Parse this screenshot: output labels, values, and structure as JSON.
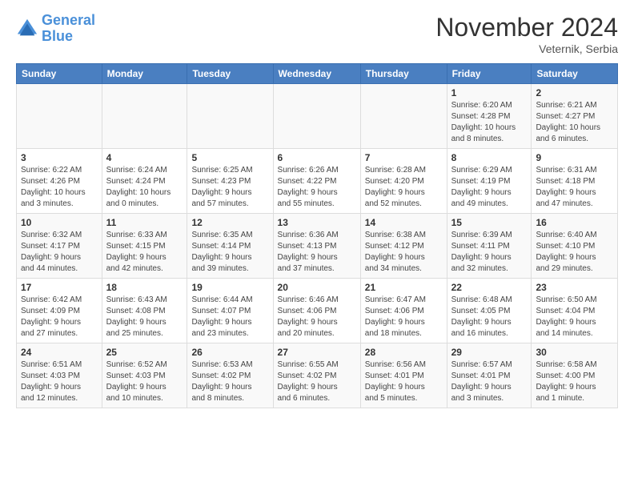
{
  "header": {
    "logo_line1": "General",
    "logo_line2": "Blue",
    "title": "November 2024",
    "location": "Veternik, Serbia"
  },
  "days_of_week": [
    "Sunday",
    "Monday",
    "Tuesday",
    "Wednesday",
    "Thursday",
    "Friday",
    "Saturday"
  ],
  "weeks": [
    [
      {
        "day": "",
        "info": ""
      },
      {
        "day": "",
        "info": ""
      },
      {
        "day": "",
        "info": ""
      },
      {
        "day": "",
        "info": ""
      },
      {
        "day": "",
        "info": ""
      },
      {
        "day": "1",
        "info": "Sunrise: 6:20 AM\nSunset: 4:28 PM\nDaylight: 10 hours\nand 8 minutes."
      },
      {
        "day": "2",
        "info": "Sunrise: 6:21 AM\nSunset: 4:27 PM\nDaylight: 10 hours\nand 6 minutes."
      }
    ],
    [
      {
        "day": "3",
        "info": "Sunrise: 6:22 AM\nSunset: 4:26 PM\nDaylight: 10 hours\nand 3 minutes."
      },
      {
        "day": "4",
        "info": "Sunrise: 6:24 AM\nSunset: 4:24 PM\nDaylight: 10 hours\nand 0 minutes."
      },
      {
        "day": "5",
        "info": "Sunrise: 6:25 AM\nSunset: 4:23 PM\nDaylight: 9 hours\nand 57 minutes."
      },
      {
        "day": "6",
        "info": "Sunrise: 6:26 AM\nSunset: 4:22 PM\nDaylight: 9 hours\nand 55 minutes."
      },
      {
        "day": "7",
        "info": "Sunrise: 6:28 AM\nSunset: 4:20 PM\nDaylight: 9 hours\nand 52 minutes."
      },
      {
        "day": "8",
        "info": "Sunrise: 6:29 AM\nSunset: 4:19 PM\nDaylight: 9 hours\nand 49 minutes."
      },
      {
        "day": "9",
        "info": "Sunrise: 6:31 AM\nSunset: 4:18 PM\nDaylight: 9 hours\nand 47 minutes."
      }
    ],
    [
      {
        "day": "10",
        "info": "Sunrise: 6:32 AM\nSunset: 4:17 PM\nDaylight: 9 hours\nand 44 minutes."
      },
      {
        "day": "11",
        "info": "Sunrise: 6:33 AM\nSunset: 4:15 PM\nDaylight: 9 hours\nand 42 minutes."
      },
      {
        "day": "12",
        "info": "Sunrise: 6:35 AM\nSunset: 4:14 PM\nDaylight: 9 hours\nand 39 minutes."
      },
      {
        "day": "13",
        "info": "Sunrise: 6:36 AM\nSunset: 4:13 PM\nDaylight: 9 hours\nand 37 minutes."
      },
      {
        "day": "14",
        "info": "Sunrise: 6:38 AM\nSunset: 4:12 PM\nDaylight: 9 hours\nand 34 minutes."
      },
      {
        "day": "15",
        "info": "Sunrise: 6:39 AM\nSunset: 4:11 PM\nDaylight: 9 hours\nand 32 minutes."
      },
      {
        "day": "16",
        "info": "Sunrise: 6:40 AM\nSunset: 4:10 PM\nDaylight: 9 hours\nand 29 minutes."
      }
    ],
    [
      {
        "day": "17",
        "info": "Sunrise: 6:42 AM\nSunset: 4:09 PM\nDaylight: 9 hours\nand 27 minutes."
      },
      {
        "day": "18",
        "info": "Sunrise: 6:43 AM\nSunset: 4:08 PM\nDaylight: 9 hours\nand 25 minutes."
      },
      {
        "day": "19",
        "info": "Sunrise: 6:44 AM\nSunset: 4:07 PM\nDaylight: 9 hours\nand 23 minutes."
      },
      {
        "day": "20",
        "info": "Sunrise: 6:46 AM\nSunset: 4:06 PM\nDaylight: 9 hours\nand 20 minutes."
      },
      {
        "day": "21",
        "info": "Sunrise: 6:47 AM\nSunset: 4:06 PM\nDaylight: 9 hours\nand 18 minutes."
      },
      {
        "day": "22",
        "info": "Sunrise: 6:48 AM\nSunset: 4:05 PM\nDaylight: 9 hours\nand 16 minutes."
      },
      {
        "day": "23",
        "info": "Sunrise: 6:50 AM\nSunset: 4:04 PM\nDaylight: 9 hours\nand 14 minutes."
      }
    ],
    [
      {
        "day": "24",
        "info": "Sunrise: 6:51 AM\nSunset: 4:03 PM\nDaylight: 9 hours\nand 12 minutes."
      },
      {
        "day": "25",
        "info": "Sunrise: 6:52 AM\nSunset: 4:03 PM\nDaylight: 9 hours\nand 10 minutes."
      },
      {
        "day": "26",
        "info": "Sunrise: 6:53 AM\nSunset: 4:02 PM\nDaylight: 9 hours\nand 8 minutes."
      },
      {
        "day": "27",
        "info": "Sunrise: 6:55 AM\nSunset: 4:02 PM\nDaylight: 9 hours\nand 6 minutes."
      },
      {
        "day": "28",
        "info": "Sunrise: 6:56 AM\nSunset: 4:01 PM\nDaylight: 9 hours\nand 5 minutes."
      },
      {
        "day": "29",
        "info": "Sunrise: 6:57 AM\nSunset: 4:01 PM\nDaylight: 9 hours\nand 3 minutes."
      },
      {
        "day": "30",
        "info": "Sunrise: 6:58 AM\nSunset: 4:00 PM\nDaylight: 9 hours\nand 1 minute."
      }
    ]
  ]
}
